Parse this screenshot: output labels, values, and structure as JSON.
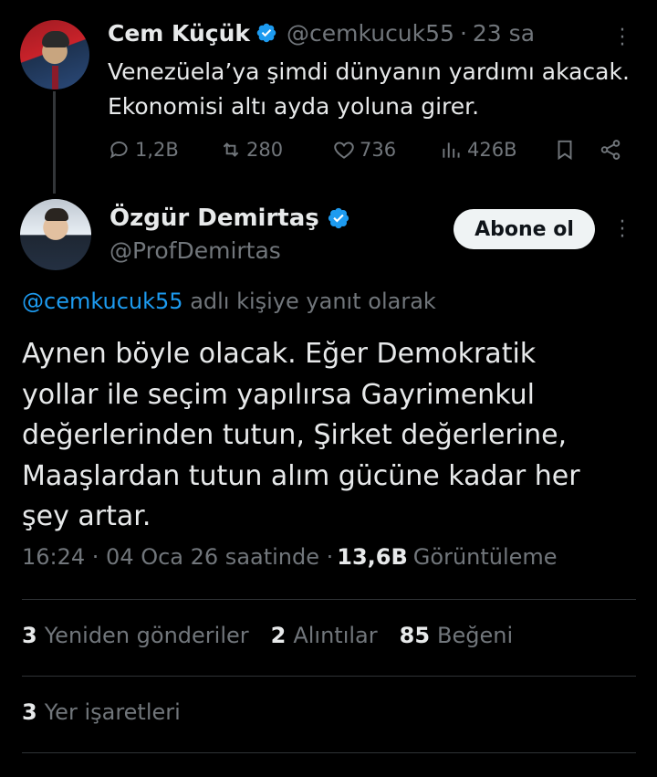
{
  "parent_tweet": {
    "name": "Cem Küçük",
    "handle": "@cemkucuk55",
    "separator": "·",
    "time": "23 sa",
    "text_line1": "Venezüela’ya şimdi dünyanın yardımı akacak.",
    "text_line2": "Ekonomisi altı ayda yoluna girer.",
    "replies": "1,2B",
    "retweets": "280",
    "likes": "736",
    "views": "426B"
  },
  "reply_tweet": {
    "name": "Özgür Demirtaş",
    "handle": "@ProfDemirtas",
    "follow_label": "Abone ol",
    "reply_to_mention": "@cemkucuk55",
    "reply_to_suffix": " adlı kişiye yanıt olarak",
    "text_lines": [
      "Aynen böyle olacak. Eğer Demokratik",
      "yollar ile seçim yapılırsa Gayrimenkul",
      "değerlerinden tutun, Şirket değerlerine,",
      "Maaşlardan tutun alım gücüne kadar her",
      "şey artar."
    ],
    "timestamp": "16:24 · 04 Oca 26 saatinde ·",
    "view_count": "13,6B",
    "view_label": "Görüntüleme",
    "reposts_count": "3",
    "reposts_label": "Yeniden gönderiler",
    "quotes_count": "2",
    "quotes_label": "Alıntılar",
    "likes_count": "85",
    "likes_label": "Beğeni",
    "bookmarks_count": "3",
    "bookmarks_label": "Yer işaretleri"
  },
  "icons": {
    "verified": "verified-badge-icon",
    "reply": "reply-icon",
    "retweet": "retweet-icon",
    "like": "heart-icon",
    "views": "analytics-icon",
    "bookmark": "bookmark-icon",
    "share": "share-icon",
    "more": "more-options-icon"
  },
  "colors": {
    "background": "#000000",
    "text": "#e7e9ea",
    "muted": "#71767b",
    "accent": "#1d9bf0",
    "divider": "#2f3336"
  }
}
